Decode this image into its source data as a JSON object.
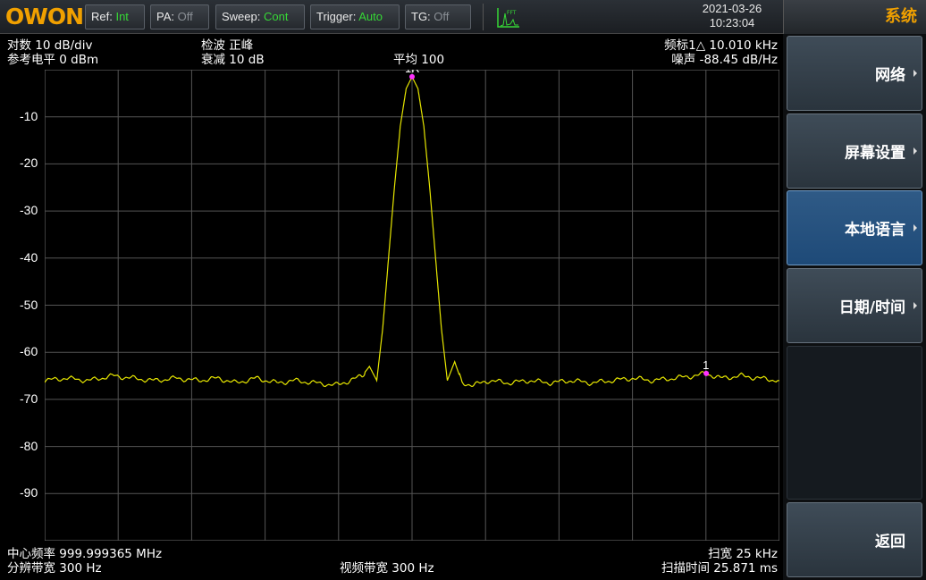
{
  "topbar": {
    "logo": "OWON",
    "buttons": [
      {
        "key": "Ref:",
        "value": "Int",
        "state": "on"
      },
      {
        "key": "PA:",
        "value": "Off",
        "state": "off"
      },
      {
        "key": "Sweep:",
        "value": "Cont",
        "state": "on"
      },
      {
        "key": "Trigger:",
        "value": "Auto",
        "state": "on"
      },
      {
        "key": "TG:",
        "value": "Off",
        "state": "off"
      }
    ],
    "fft_label": "FFT",
    "date": "2021-03-26",
    "time": "10:23:04"
  },
  "menu": {
    "title": "系统",
    "items": [
      {
        "label": "网络",
        "active": false
      },
      {
        "label": "屏幕设置",
        "active": false
      },
      {
        "label": "本地语言",
        "active": true
      },
      {
        "label": "日期/时间",
        "active": false
      },
      {
        "label": "返回",
        "active": false
      }
    ]
  },
  "screen": {
    "scale": "对数 10 dB/div",
    "ref_level": "参考电平 0 dBm",
    "detector": "检波 正峰",
    "attenuation": "衰减 10 dB",
    "average": "平均 100",
    "marker_readout": "频标1△  10.010 kHz",
    "noise_readout": "噪声  -88.45 dB/Hz",
    "center_freq": "中心频率 999.999365 MHz",
    "rbw": "分辨带宽 300 Hz",
    "vbw": "视频带宽 300 Hz",
    "span": "扫宽 25 kHz",
    "sweep_time": "扫描时间 25.871 ms",
    "marker_ref_label": "1R",
    "marker_label": "1"
  },
  "colors": {
    "trace": "#e6e600",
    "marker": "#ff30ff",
    "grid": "#555555",
    "accent": "#f0a000",
    "on_value": "#36d836"
  },
  "chart_data": {
    "type": "line",
    "x_unit": "kHz offset from center",
    "xlim": [
      -12.5,
      12.5
    ],
    "ylim": [
      -100,
      0
    ],
    "y_ticks": [
      -10,
      -20,
      -30,
      -40,
      -50,
      -60,
      -70,
      -80,
      -90
    ],
    "grid": true,
    "series": [
      {
        "x": [
          -12.5,
          -11.8,
          -11.0,
          -10.2,
          -9.5,
          -8.8,
          -8.0,
          -7.3,
          -6.6,
          -6.0,
          -5.3,
          -4.6,
          -4.0,
          -3.3,
          -2.6,
          -2.1,
          -1.7,
          -1.45,
          -1.2,
          -1.0,
          -0.8,
          -0.6,
          -0.4,
          -0.2,
          0.0,
          0.2,
          0.4,
          0.6,
          0.8,
          1.0,
          1.2,
          1.45,
          1.7,
          2.1,
          2.6,
          3.3,
          4.0,
          4.7,
          5.4,
          6.1,
          6.8,
          7.5,
          8.2,
          8.9,
          9.6,
          10.0,
          10.5,
          11.2,
          11.8,
          12.5
        ],
        "y": [
          -66,
          -65.5,
          -66,
          -65,
          -65.5,
          -66,
          -65.5,
          -66,
          -65.5,
          -66.5,
          -65.5,
          -66.5,
          -66,
          -66.5,
          -67,
          -66,
          -65,
          -63,
          -66,
          -55,
          -40,
          -25,
          -12,
          -4,
          -1.5,
          -4,
          -12,
          -25,
          -40,
          -55,
          -66,
          -62,
          -66.5,
          -67,
          -66,
          -66.5,
          -66,
          -66.5,
          -66,
          -66.5,
          -66,
          -65.5,
          -66,
          -65.5,
          -65,
          -64.5,
          -65.5,
          -65,
          -65.5,
          -66
        ]
      }
    ],
    "markers": [
      {
        "label": "1R",
        "x": 0.0,
        "y": -1.5
      },
      {
        "label": "1",
        "x": 10.01,
        "y": -64.5
      }
    ]
  }
}
